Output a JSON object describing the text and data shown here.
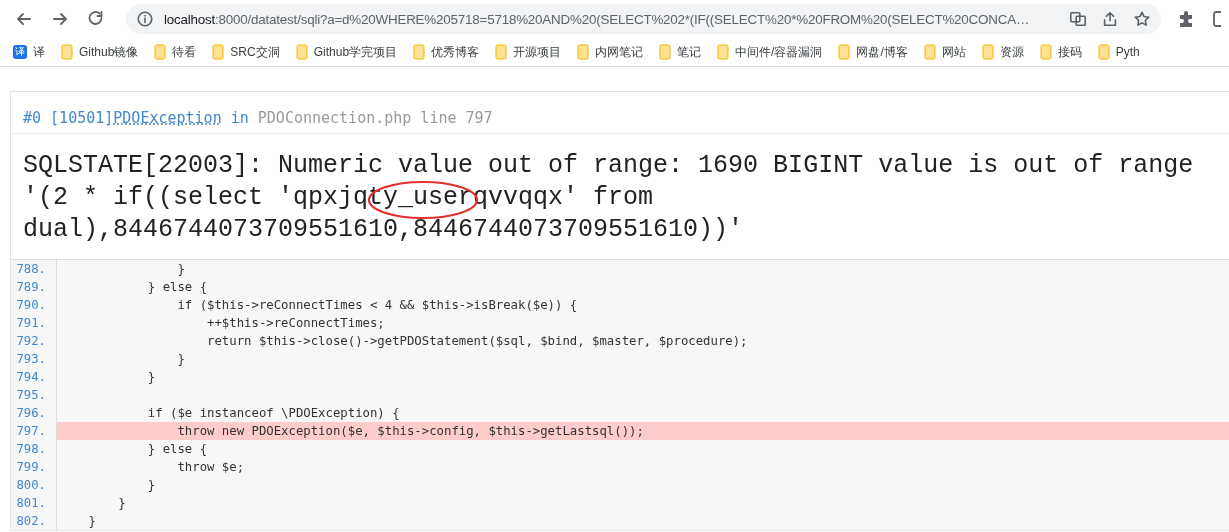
{
  "browser": {
    "url_host": "localhost",
    "url_rest": ":8000/datatest/sqli?a=d%20WHERE%205718=5718%20AND%20(SELECT%202*(IF((SELECT%20*%20FROM%20(SELECT%20CONCA…",
    "bookmarks": [
      {
        "kind": "app",
        "glyph": "译",
        "label": "译"
      },
      {
        "kind": "folder",
        "label": "Github镜像"
      },
      {
        "kind": "folder",
        "label": "待看"
      },
      {
        "kind": "folder",
        "label": "SRC交洞"
      },
      {
        "kind": "folder",
        "label": "Github学完项目"
      },
      {
        "kind": "folder",
        "label": "优秀博客"
      },
      {
        "kind": "folder",
        "label": "开源项目"
      },
      {
        "kind": "folder",
        "label": "内网笔记"
      },
      {
        "kind": "folder",
        "label": "笔记"
      },
      {
        "kind": "folder",
        "label": "中间件/容器漏洞"
      },
      {
        "kind": "folder",
        "label": "网盘/博客"
      },
      {
        "kind": "folder",
        "label": "网站"
      },
      {
        "kind": "folder",
        "label": "资源"
      },
      {
        "kind": "folder",
        "label": "接码"
      },
      {
        "kind": "folder",
        "label": "Pyth"
      }
    ]
  },
  "exception": {
    "prefix": "#0 [10501]",
    "class_link": "PDOException",
    "connector": "in",
    "location": "PDOConnection.php line 797",
    "message": "SQLSTATE[22003]: Numeric value out of range: 1690 BIGINT value is out of range '(2 * if((select 'qpxjqty_userqvvqqx' from dual),8446744073709551610,8446744073709551610))'",
    "annotation": {
      "kind": "ellipse",
      "color": "#e03030"
    }
  },
  "code": [
    {
      "number": "788.",
      "text": "                }",
      "highlighted": false
    },
    {
      "number": "789.",
      "text": "            } else {",
      "highlighted": false
    },
    {
      "number": "790.",
      "text": "                if ($this->reConnectTimes < 4 && $this->isBreak($e)) {",
      "highlighted": false
    },
    {
      "number": "791.",
      "text": "                    ++$this->reConnectTimes;",
      "highlighted": false
    },
    {
      "number": "792.",
      "text": "                    return $this->close()->getPDOStatement($sql, $bind, $master, $procedure);",
      "highlighted": false
    },
    {
      "number": "793.",
      "text": "                }",
      "highlighted": false
    },
    {
      "number": "794.",
      "text": "            }",
      "highlighted": false
    },
    {
      "number": "795.",
      "highlighted": false
    },
    {
      "number": "796.",
      "text": "            if ($e instanceof \\PDOException) {",
      "highlighted": false
    },
    {
      "number": "797.",
      "text": "                throw new PDOException($e, $this->config, $this->getLastsql());",
      "highlighted": true
    },
    {
      "number": "798.",
      "text": "            } else {",
      "highlighted": false
    },
    {
      "number": "799.",
      "text": "                throw $e;",
      "highlighted": false
    },
    {
      "number": "800.",
      "text": "            }",
      "highlighted": false
    },
    {
      "number": "801.",
      "text": "        }",
      "highlighted": false
    },
    {
      "number": "802.",
      "text": "    }",
      "highlighted": false
    }
  ]
}
